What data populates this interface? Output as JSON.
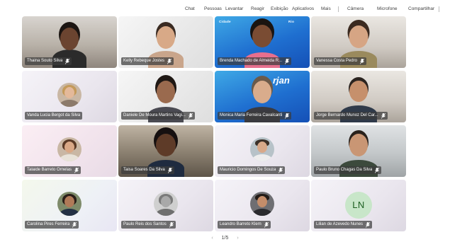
{
  "toolbar": {
    "items": [
      "Chat",
      "Pessoas",
      "Levantar",
      "Reagir",
      "Exibição",
      "Aplicativos",
      "Mais",
      "Câmera",
      "Microfone",
      "Compartilhar"
    ]
  },
  "participants": [
    {
      "name": "Thaina Souto Silva"
    },
    {
      "name": "Kelly Rebeque Jostes"
    },
    {
      "name": "Brenda Machado de Almeida R..."
    },
    {
      "name": "Vanessa Costa Pedro"
    },
    {
      "name": "Vanda Lucia Bergot da Silva"
    },
    {
      "name": "Daniele De Moura Martins Vagi..."
    },
    {
      "name": "Monica Maria Ferreira Cavalcanti"
    },
    {
      "name": "Jorge Bernardo Munoz Del Car..."
    },
    {
      "name": "Talaide Barreto Ornelas"
    },
    {
      "name": "Taisa Soares Da Silva"
    },
    {
      "name": "Mauricio Domingos De Souza"
    },
    {
      "name": "Paulo Bruno Chagas Da Silva"
    },
    {
      "name": "Carolina Pires Ferreira"
    },
    {
      "name": "Paulo Reis dos Santos"
    },
    {
      "name": "Leandro Barreto Klem"
    },
    {
      "name": "Lilian de Azevedo Nunes",
      "initials": "LN"
    }
  ],
  "brand": {
    "small": "Cidade",
    "small_right": "Rio",
    "big": "rjan"
  },
  "pager": {
    "prev": "‹",
    "label": "1/5",
    "next": "›"
  }
}
